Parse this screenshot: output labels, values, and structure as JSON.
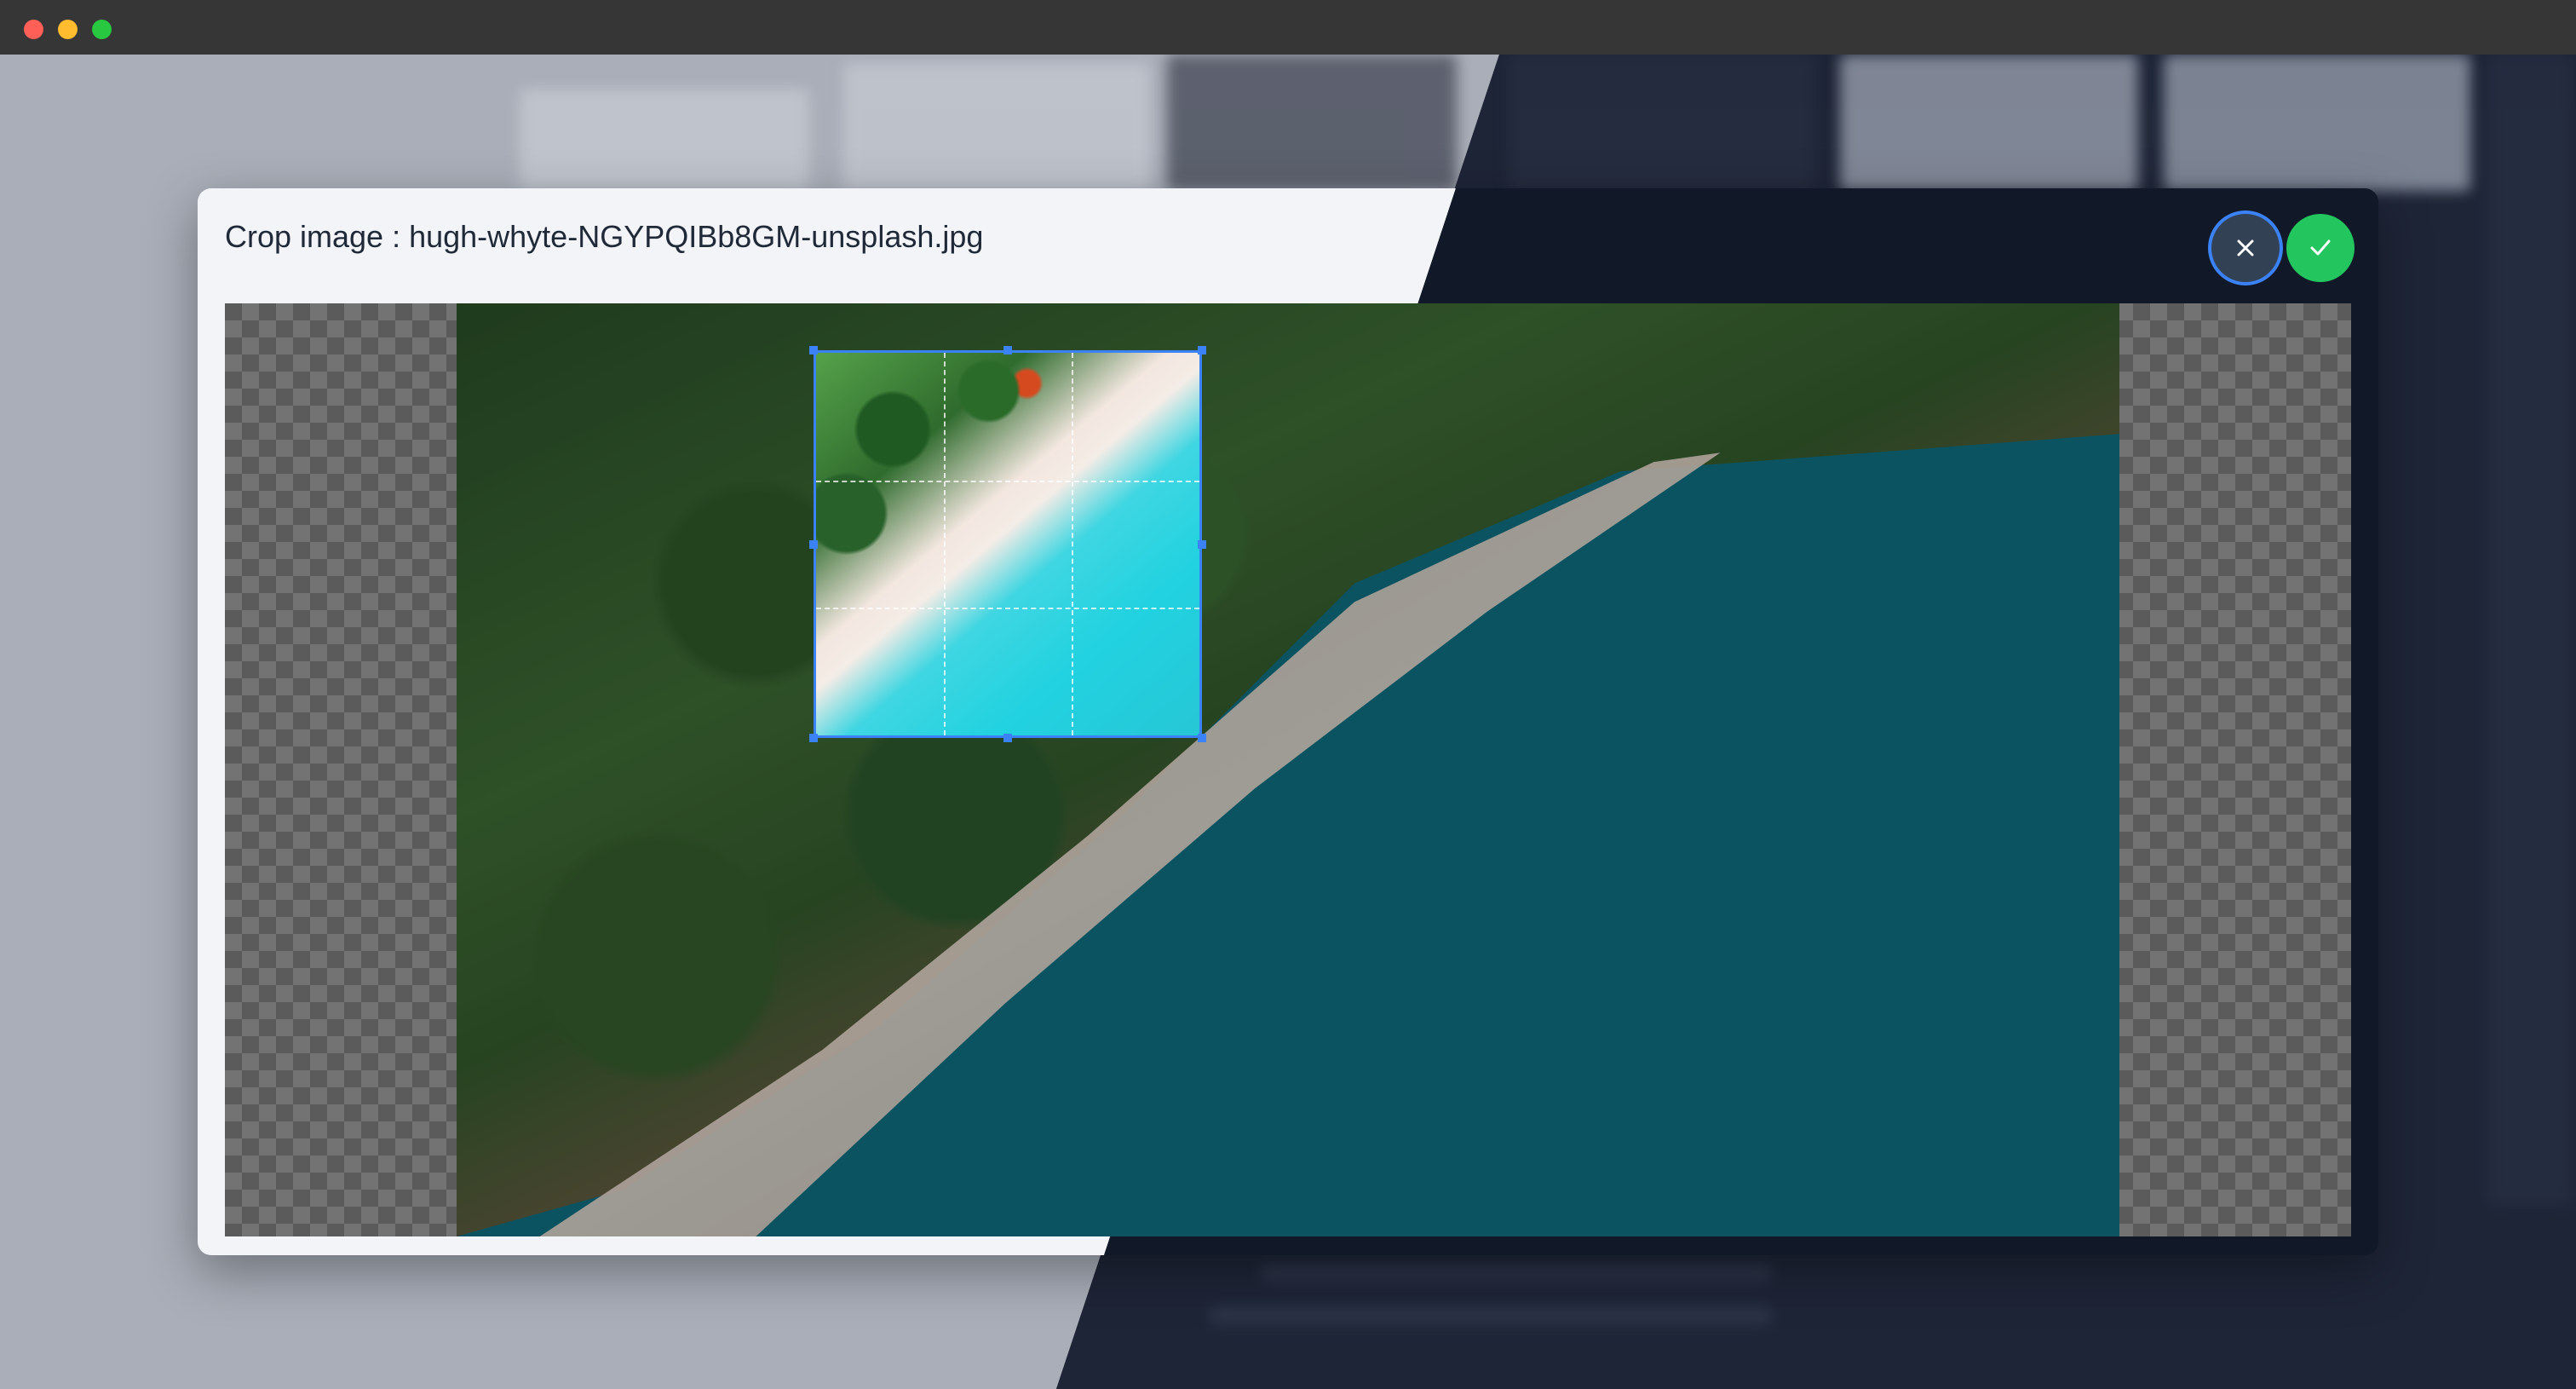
{
  "window": {
    "controls": [
      "close",
      "minimize",
      "zoom"
    ]
  },
  "modal": {
    "title": "Crop image : hugh-whyte-NGYPQIBb8GM-unsplash.jpg",
    "cancel_icon": "close-icon",
    "confirm_icon": "check-icon"
  },
  "colors": {
    "accent": "#3b82f6",
    "confirm": "#22c55e",
    "cancel": "#334155",
    "modal_light": "#f2f4f7",
    "modal_dark": "#111827"
  }
}
